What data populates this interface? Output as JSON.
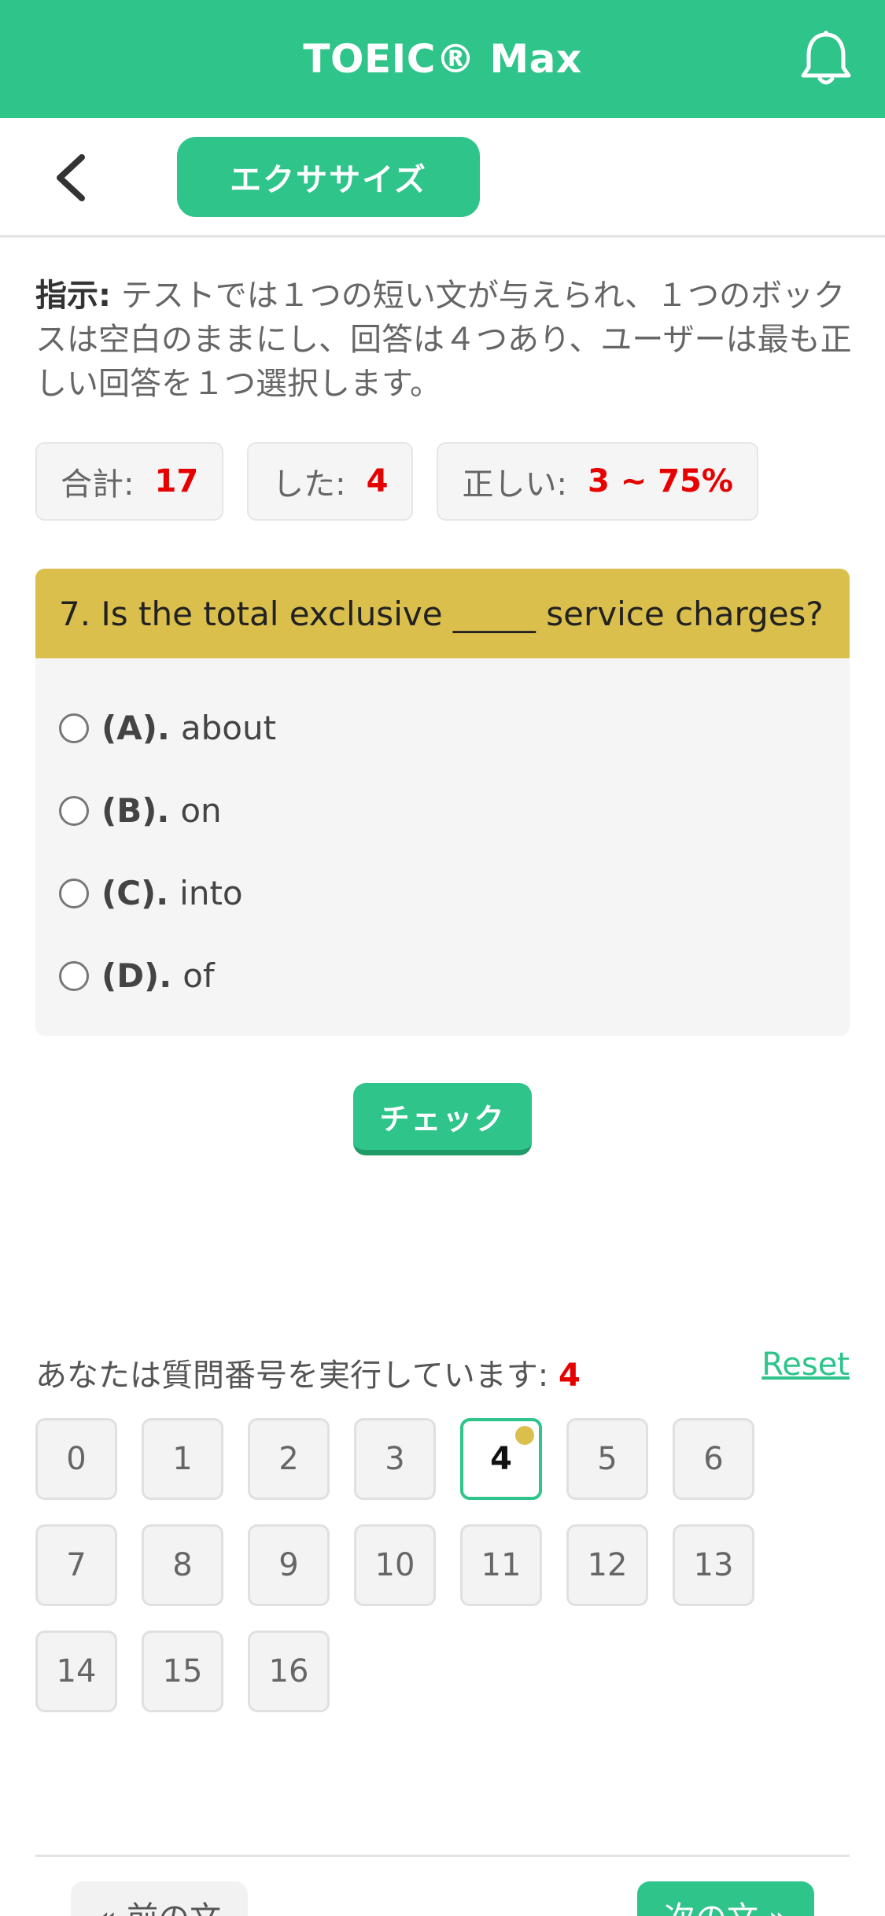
{
  "header": {
    "title": "TOEIC® Max",
    "bell_icon": "bell-icon",
    "color": "#2ec48a"
  },
  "subbar": {
    "back_icon": "chevron-left-icon",
    "tab_label": "エクササイズ"
  },
  "instruction": {
    "label": "指示:",
    "text": " テストでは１つの短い文が与えられ、１つのボックスは空白のままにし、回答は４つあり、ユーザーは最も正しい回答を１つ選択します。"
  },
  "stats": {
    "total_label": "合計:",
    "total_value": "17",
    "done_label": "した:",
    "done_value": "4",
    "correct_label": "正しい:",
    "correct_value": "3 ~ 75%"
  },
  "question": {
    "text": "7. Is the total exclusive _____ service charges?",
    "options": [
      {
        "label": "(A).",
        "text": "about"
      },
      {
        "label": "(B).",
        "text": "on"
      },
      {
        "label": "(C).",
        "text": "into"
      },
      {
        "label": "(D).",
        "text": "of"
      }
    ]
  },
  "check_label": "チェック",
  "progress": {
    "label": "あなたは質問番号を実行しています: ",
    "current": "4",
    "reset_label": "Reset",
    "numbers": [
      "0",
      "1",
      "2",
      "3",
      "4",
      "5",
      "6",
      "7",
      "8",
      "9",
      "10",
      "11",
      "12",
      "13",
      "14",
      "15",
      "16"
    ]
  },
  "nav": {
    "prev_label": "« 前の文",
    "next_label": "次の文 »"
  },
  "colors": {
    "accent": "#2ec48a",
    "question_header": "#dbbf4d",
    "highlight": "#e60000"
  }
}
